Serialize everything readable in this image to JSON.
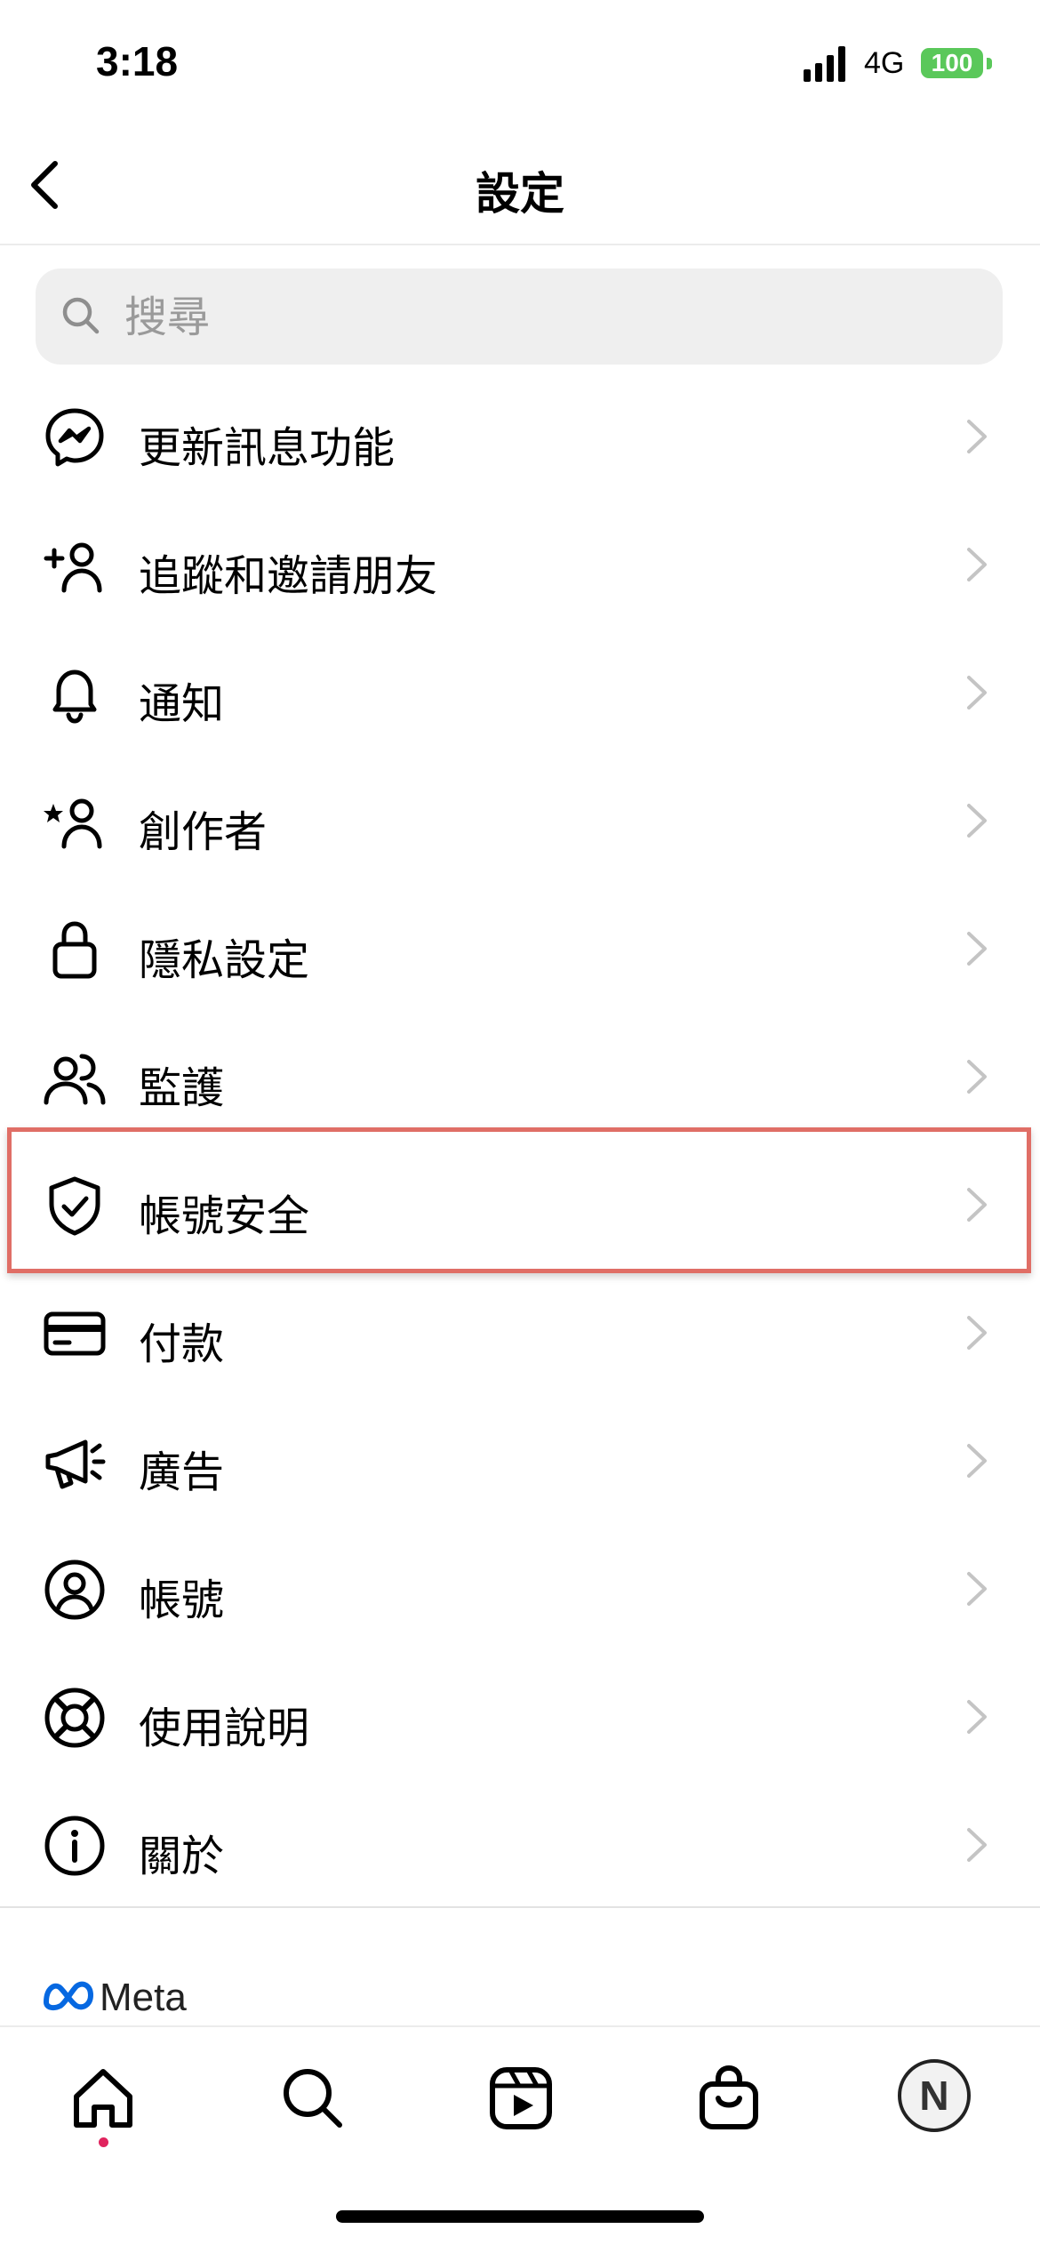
{
  "status_bar": {
    "time": "3:18",
    "network": "4G",
    "battery": "100"
  },
  "header": {
    "title": "設定"
  },
  "search": {
    "placeholder": "搜尋"
  },
  "menu": {
    "items": [
      {
        "label": "更新訊息功能",
        "icon": "messenger-icon"
      },
      {
        "label": "追蹤和邀請朋友",
        "icon": "add-person-icon"
      },
      {
        "label": "通知",
        "icon": "bell-icon"
      },
      {
        "label": "創作者",
        "icon": "creator-star-person-icon"
      },
      {
        "label": "隱私設定",
        "icon": "lock-icon"
      },
      {
        "label": "監護",
        "icon": "supervision-people-icon"
      },
      {
        "label": "帳號安全",
        "icon": "shield-check-icon",
        "highlighted": true
      },
      {
        "label": "付款",
        "icon": "credit-card-icon"
      },
      {
        "label": "廣告",
        "icon": "megaphone-icon"
      },
      {
        "label": "帳號",
        "icon": "account-circle-icon"
      },
      {
        "label": "使用說明",
        "icon": "lifebuoy-icon"
      },
      {
        "label": "關於",
        "icon": "info-icon"
      }
    ]
  },
  "footer": {
    "brand": "Meta"
  },
  "tabbar": {
    "tabs": [
      "home-icon",
      "search-icon",
      "reels-icon",
      "shop-icon",
      "profile-avatar"
    ],
    "avatar_initial": "N"
  },
  "colors": {
    "highlight": "#e06e66",
    "battery": "#5ac85a",
    "meta_blue": "#0668e1",
    "notification_dot": "#e0245e"
  }
}
